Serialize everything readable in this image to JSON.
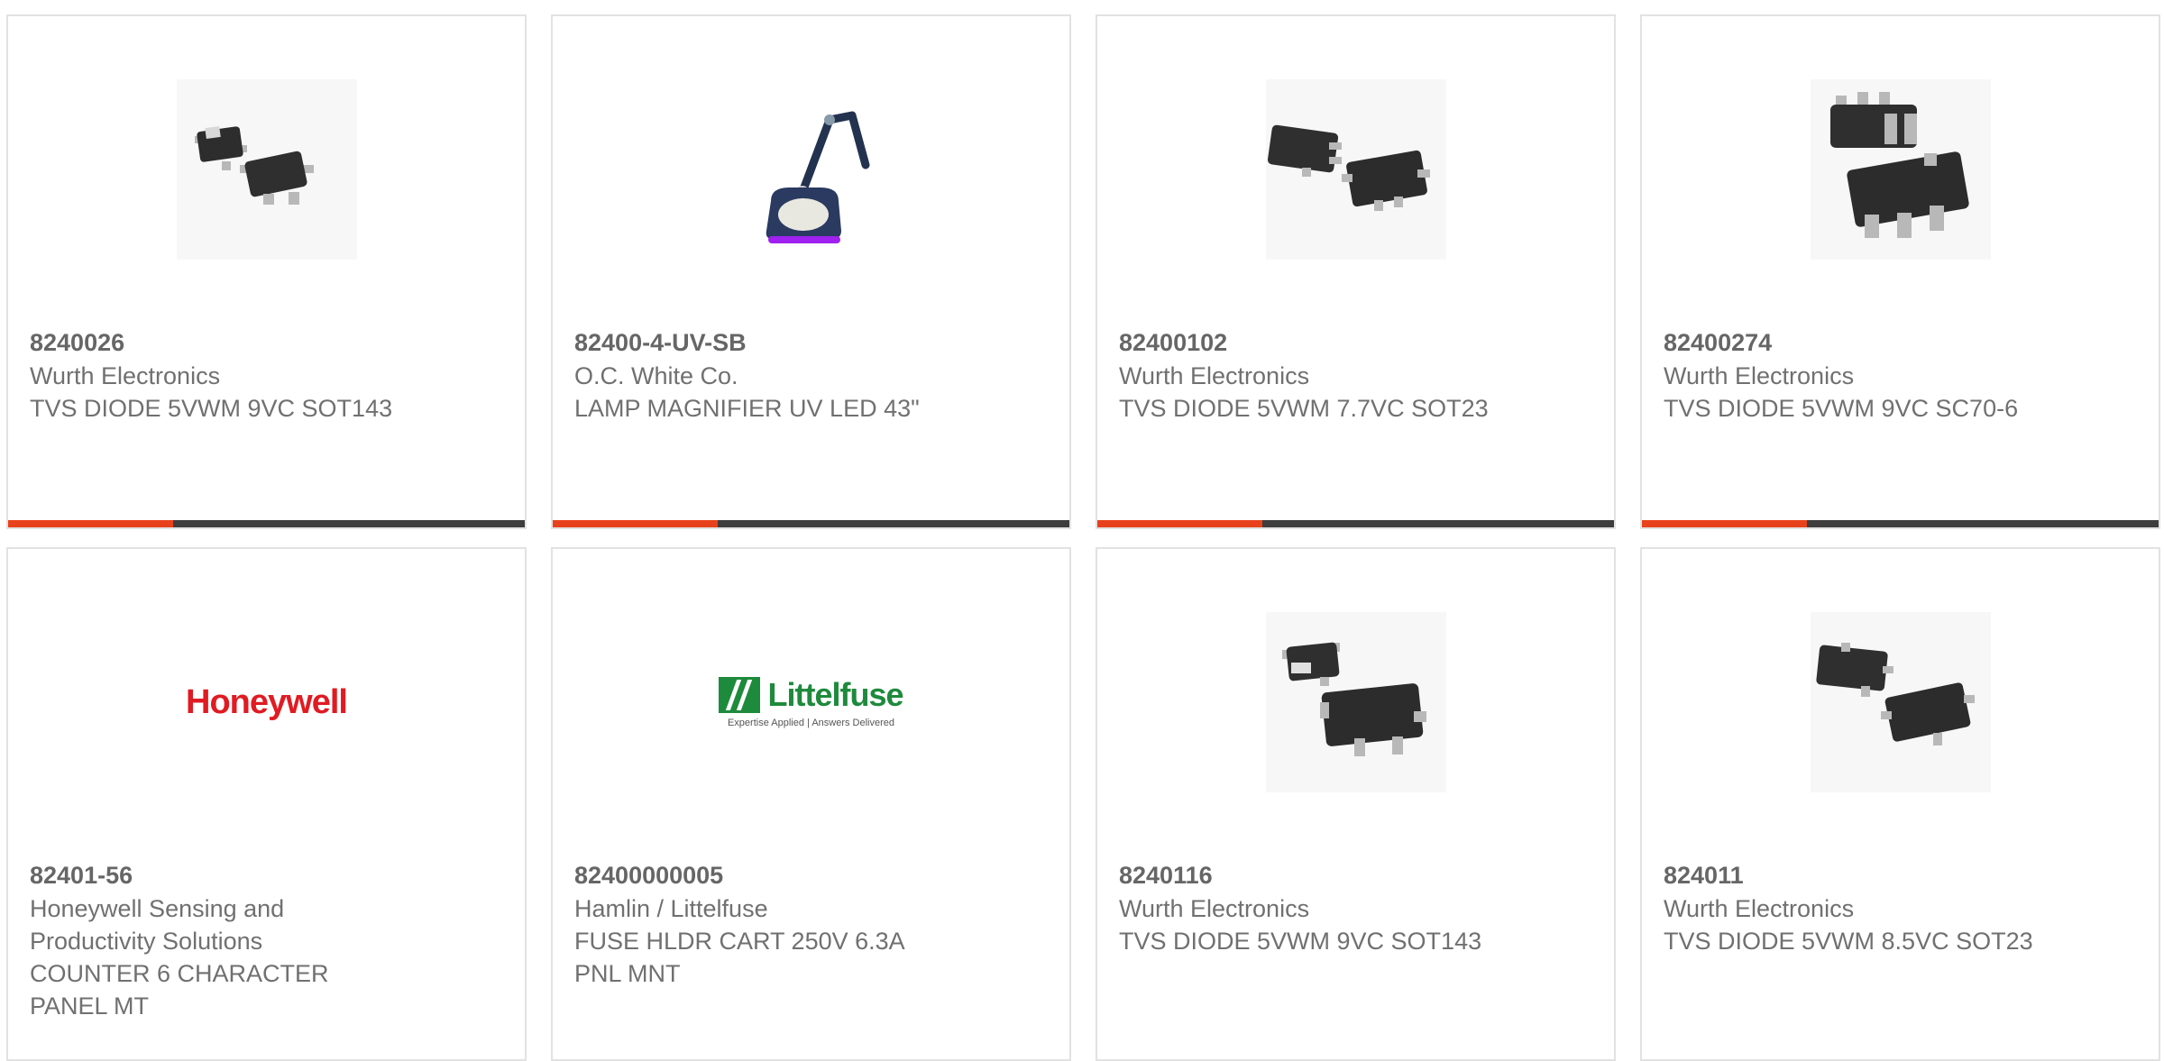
{
  "products": [
    {
      "part_number": "8240026",
      "manufacturer": "Wurth Electronics",
      "description": "TVS DIODE 5VWM 9VC SOT143",
      "image_icon": "sot143-chip-icon",
      "progress": 0.32
    },
    {
      "part_number": "82400-4-UV-SB",
      "manufacturer": "O.C. White Co.",
      "description": "LAMP MAGNIFIER UV LED 43\"",
      "image_icon": "magnifier-lamp-icon",
      "progress": 0.32
    },
    {
      "part_number": "82400102",
      "manufacturer": "Wurth Electronics",
      "description": "TVS DIODE 5VWM 7.7VC SOT23",
      "image_icon": "sot23-chip-icon",
      "progress": 0.32
    },
    {
      "part_number": "82400274",
      "manufacturer": "Wurth Electronics",
      "description": "TVS DIODE 5VWM 9VC SC70-6",
      "image_icon": "sc70-chip-icon",
      "progress": 0.32
    },
    {
      "part_number": "82401-56",
      "manufacturer": "Honeywell Sensing and Productivity Solutions",
      "description": "COUNTER 6 CHARACTER PANEL MT",
      "logo_text": "Honeywell",
      "image_icon": "honeywell-logo",
      "progress": 0
    },
    {
      "part_number": "82400000005",
      "manufacturer": "Hamlin / Littelfuse",
      "description": "FUSE HLDR CART 250V 6.3A PNL MNT",
      "logo_text": "Littelfuse",
      "logo_tagline": "Expertise Applied  |  Answers Delivered",
      "image_icon": "littelfuse-logo",
      "progress": 0
    },
    {
      "part_number": "8240116",
      "manufacturer": "Wurth Electronics",
      "description": "TVS DIODE 5VWM 9VC SOT143",
      "image_icon": "sot143-chip-icon",
      "progress": 0
    },
    {
      "part_number": "824011",
      "manufacturer": "Wurth Electronics",
      "description": "TVS DIODE 5VWM 8.5VC SOT23",
      "image_icon": "sot23-chip-icon",
      "progress": 0
    }
  ],
  "colors": {
    "accent": "#e8421c",
    "track": "#3d3d3d",
    "text": "#666666",
    "border": "#e2e2e2",
    "honeywell_red": "#e01b22",
    "littelfuse_green": "#1e8a3c"
  }
}
